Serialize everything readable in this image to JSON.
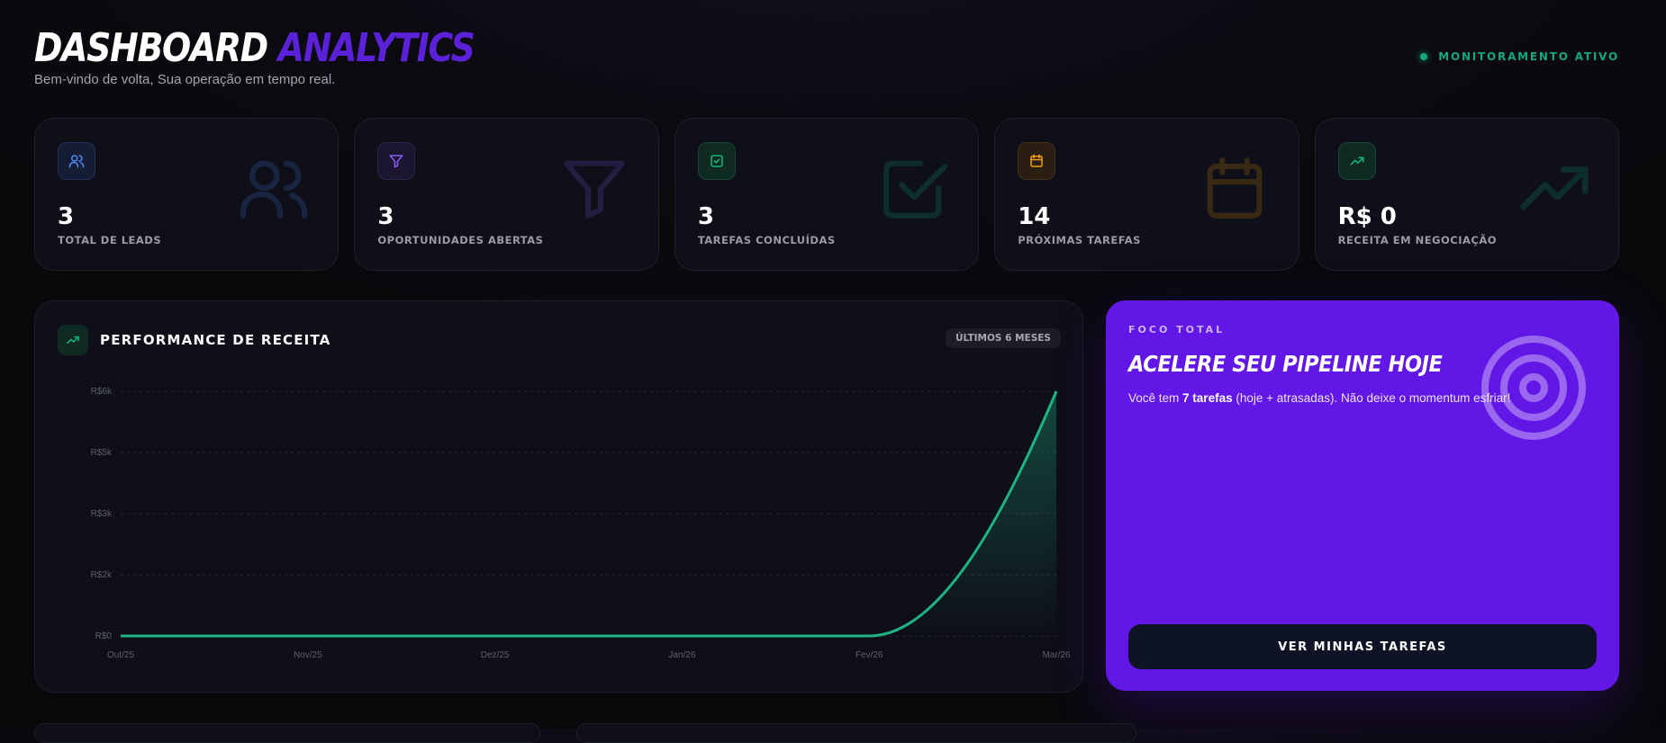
{
  "header": {
    "title_part1": "DASHBOARD",
    "title_part2": "ANALYTICS",
    "subtitle": "Bem-vindo de volta, Sua operação em tempo real.",
    "status_text": "MONITORAMENTO ATIVO",
    "status_color": "#16a77d"
  },
  "stats": [
    {
      "icon": "users-icon",
      "value": "3",
      "label": "TOTAL DE LEADS",
      "color": "#4f8cf7"
    },
    {
      "icon": "funnel-icon",
      "value": "3",
      "label": "OPORTUNIDADES ABERTAS",
      "color": "#8b5cf6"
    },
    {
      "icon": "checkbox-icon",
      "value": "3",
      "label": "TAREFAS CONCLUÍDAS",
      "color": "#10b981"
    },
    {
      "icon": "calendar-icon",
      "value": "14",
      "label": "PRÓXIMAS TAREFAS",
      "color": "#f59e0b"
    },
    {
      "icon": "trending-up-icon",
      "value": "R$ 0",
      "label": "RECEITA EM NEGOCIAÇÃO",
      "color": "#10b981"
    }
  ],
  "performance": {
    "title": "PERFORMANCE DE RECEITA",
    "badge": "ÚLTIMOS 6 MESES"
  },
  "chart_data": {
    "type": "area",
    "categories": [
      "Out/25",
      "Nov/25",
      "Dez/25",
      "Jan/26",
      "Fev/26",
      "Mar/26"
    ],
    "values": [
      0,
      0,
      0,
      0,
      0,
      6000
    ],
    "y_ticks": [
      "R$0",
      "R$2k",
      "R$3k",
      "R$5k",
      "R$6k"
    ],
    "y_tick_values": [
      0,
      1500,
      3000,
      4500,
      6000
    ],
    "ylim": [
      0,
      6000
    ],
    "grid": true,
    "color": "#1fb383"
  },
  "focus": {
    "eyebrow": "FOCO TOTAL",
    "heading": "ACELERE SEU PIPELINE HOJE",
    "desc_before": "Você tem ",
    "desc_bold": "7 tarefas",
    "desc_after": " (hoje + atrasadas). Não deixe o momentum esfriar!",
    "button": "VER MINHAS TAREFAS",
    "background": "#6217e6"
  }
}
